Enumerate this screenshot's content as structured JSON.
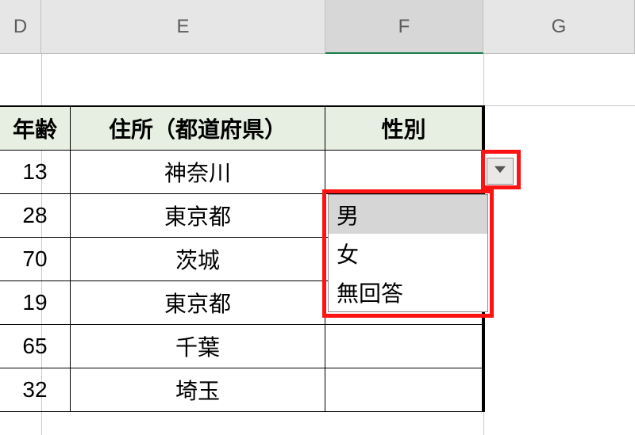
{
  "columns": {
    "D": "D",
    "E": "E",
    "F": "F",
    "G": "G"
  },
  "headers": {
    "D": "年齢",
    "E": "住所（都道府県）",
    "F": "性別"
  },
  "rows": [
    {
      "age": "13",
      "pref": "神奈川",
      "sex": ""
    },
    {
      "age": "28",
      "pref": "東京都",
      "sex": ""
    },
    {
      "age": "70",
      "pref": "茨城",
      "sex": ""
    },
    {
      "age": "19",
      "pref": "東京都",
      "sex": ""
    },
    {
      "age": "65",
      "pref": "千葉",
      "sex": ""
    },
    {
      "age": "32",
      "pref": "埼玉",
      "sex": ""
    }
  ],
  "dropdown": {
    "options": [
      "男",
      "女",
      "無回答"
    ],
    "selected_index": 0
  },
  "active_cell": "F2"
}
